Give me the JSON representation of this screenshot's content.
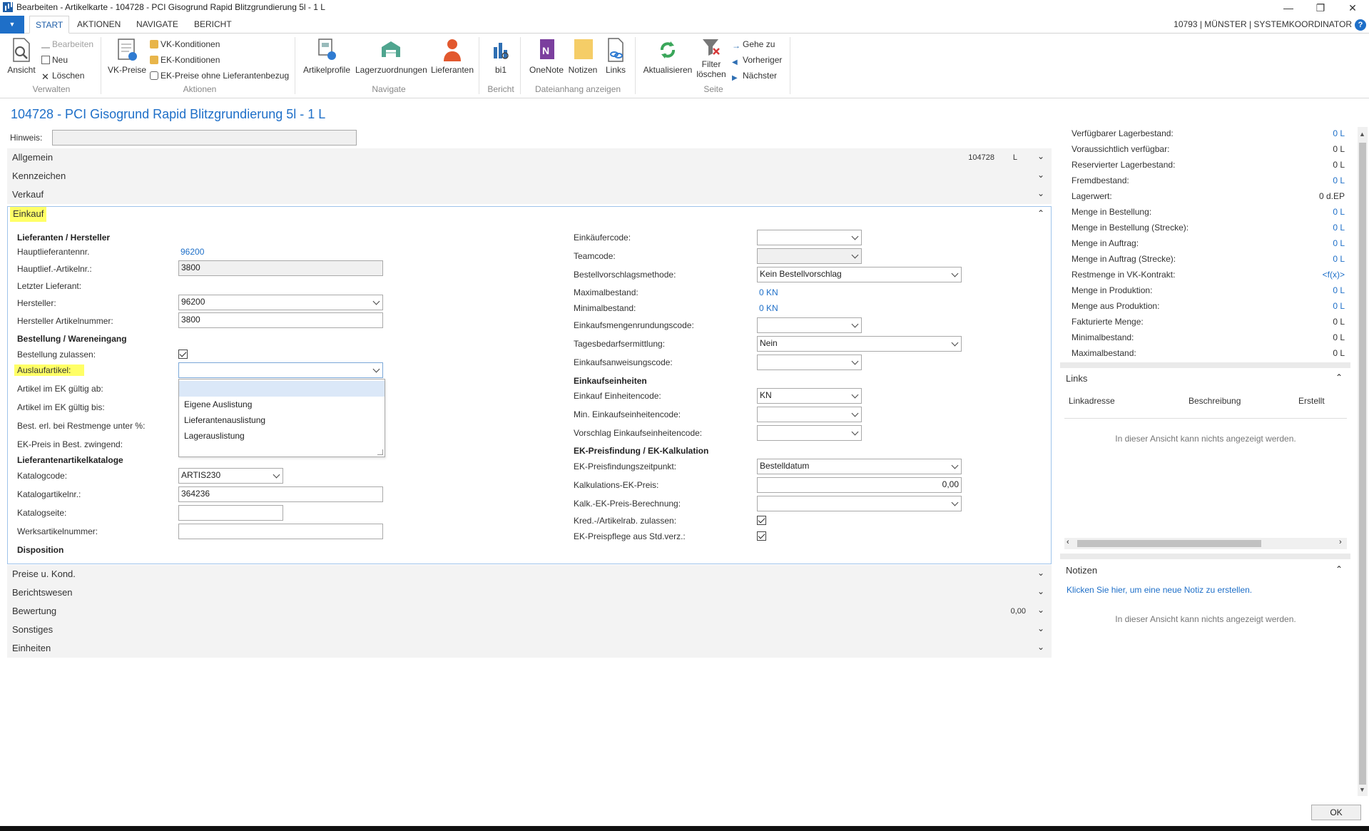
{
  "window": {
    "title": "Bearbeiten - Artikelkarte - 104728 - PCI Gisogrund Rapid Blitzgrundierung 5l - 1 L",
    "controls": {
      "minimize": "—",
      "restore": "❐",
      "close": "✕"
    }
  },
  "ribbon_tabs": {
    "start": "START",
    "aktionen": "AKTIONEN",
    "navigate": "NAVIGATE",
    "bericht": "BERICHT"
  },
  "user_info": "10793 | MÜNSTER | SYSTEMKOORDINATOR",
  "ribbon": {
    "verwalten": {
      "label": "Verwalten",
      "ansicht": "Ansicht",
      "bearbeiten": "Bearbeiten",
      "neu": "Neu",
      "loeschen": "Löschen"
    },
    "aktionen": {
      "label": "Aktionen",
      "vk_preise": "VK-Preise",
      "vk_konditionen": "VK-Konditionen",
      "ek_konditionen": "EK-Konditionen",
      "ek_preise_ohne": "EK-Preise ohne Lieferantenbezug"
    },
    "navigate": {
      "label": "Navigate",
      "artikelprofile": "Artikelprofile",
      "lagerzuordnungen": "Lagerzuordnungen",
      "lieferanten": "Lieferanten"
    },
    "bericht": {
      "label": "Bericht",
      "bi1": "bi1"
    },
    "dateianhang": {
      "label": "Dateianhang anzeigen",
      "onenote": "OneNote",
      "notizen": "Notizen",
      "links": "Links"
    },
    "seite": {
      "label": "Seite",
      "aktualisieren": "Aktualisieren",
      "filter_line1": "Filter",
      "filter_line2": "löschen",
      "gehe_zu": "Gehe zu",
      "vorheriger": "Vorheriger",
      "naechster": "Nächster"
    }
  },
  "page_title": "104728 - PCI Gisogrund Rapid Blitzgrundierung 5l - 1 L",
  "hinweis": {
    "label": "Hinweis:",
    "value": ""
  },
  "fasttabs": {
    "allgemein": {
      "label": "Allgemein",
      "summary1": "104728",
      "summary2": "L"
    },
    "kennzeichen": {
      "label": "Kennzeichen"
    },
    "verkauf": {
      "label": "Verkauf"
    },
    "einkauf": {
      "label": "Einkauf"
    },
    "preise": {
      "label": "Preise u. Kond."
    },
    "berichtswesen": {
      "label": "Berichtswesen"
    },
    "bewertung": {
      "label": "Bewertung",
      "summary1": "0,00"
    },
    "sonstiges": {
      "label": "Sonstiges"
    },
    "einheiten": {
      "label": "Einheiten"
    }
  },
  "einkauf_left": {
    "sec_lieferanten": "Lieferanten / Hersteller",
    "hauptlieferantennr": {
      "label": "Hauptlieferantennr.",
      "value": "96200"
    },
    "hauptlief_artikelnr": {
      "label": "Hauptlief.-Artikelnr.:",
      "value": "3800"
    },
    "letzter_lieferant": {
      "label": "Letzter Lieferant:"
    },
    "hersteller": {
      "label": "Hersteller:",
      "value": "96200"
    },
    "hersteller_artikelnummer": {
      "label": "Hersteller Artikelnummer:",
      "value": "3800"
    },
    "sec_bestellung": "Bestellung / Wareneingang",
    "bestellung_zulassen": {
      "label": "Bestellung zulassen:",
      "checked": true
    },
    "auslaufartikel": {
      "label": "Auslaufartikel:",
      "value": ""
    },
    "artikel_ek_ab": {
      "label": "Artikel im EK gültig ab:"
    },
    "artikel_ek_bis": {
      "label": "Artikel im EK gültig bis:"
    },
    "best_erl": {
      "label": "Best. erl. bei Restmenge unter %:"
    },
    "ek_preis_best": {
      "label": "EK-Preis in Best. zwingend:"
    },
    "sec_katalog": "Lieferantenartikelkataloge",
    "katalogcode": {
      "label": "Katalogcode:",
      "value": "ARTIS230"
    },
    "katalogartikelnr": {
      "label": "Katalogartikelnr.:",
      "value": "364236"
    },
    "katalogseite": {
      "label": "Katalogseite:",
      "value": ""
    },
    "werksartikelnummer": {
      "label": "Werksartikelnummer:",
      "value": ""
    },
    "sec_disposition": "Disposition"
  },
  "auslauf_dropdown": {
    "options": [
      "",
      "Eigene Auslistung",
      "Lieferantenauslistung",
      "Lagerauslistung"
    ]
  },
  "einkauf_right": {
    "einkaeufercode": {
      "label": "Einkäufercode:",
      "value": ""
    },
    "teamcode": {
      "label": "Teamcode:",
      "value": ""
    },
    "bestellvorschlagsmethode": {
      "label": "Bestellvorschlagsmethode:",
      "value": "Kein Bestellvorschlag"
    },
    "maximalbestand": {
      "label": "Maximalbestand:",
      "value": "0 KN"
    },
    "minimalbestand": {
      "label": "Minimalbestand:",
      "value": "0 KN"
    },
    "einkaufsmengenrundungscode": {
      "label": "Einkaufsmengenrundungscode:",
      "value": ""
    },
    "tagesbedarfsermittlung": {
      "label": "Tagesbedarfsermittlung:",
      "value": "Nein"
    },
    "einkaufsanweisungscode": {
      "label": "Einkaufsanweisungscode:",
      "value": ""
    },
    "sec_einheiten": "Einkaufseinheiten",
    "einkauf_einheitencode": {
      "label": "Einkauf Einheitencode:",
      "value": "KN"
    },
    "min_einkaufseinheitencode": {
      "label": "Min. Einkaufseinheitencode:",
      "value": ""
    },
    "vorschlag_einkaufseinheitencode": {
      "label": "Vorschlag Einkaufseinheitencode:",
      "value": ""
    },
    "sec_preisfindung": "EK-Preisfindung / EK-Kalkulation",
    "ek_preisfindungszeitpunkt": {
      "label": "EK-Preisfindungszeitpunkt:",
      "value": "Bestelldatum"
    },
    "kalkulations_ek_preis": {
      "label": "Kalkulations-EK-Preis:",
      "value": "0,00"
    },
    "kalk_ek_preis_berechnung": {
      "label": "Kalk.-EK-Preis-Berechnung:",
      "value": ""
    },
    "kred_artikelrab": {
      "label": "Kred.-/Artikelrab. zulassen:",
      "checked": true
    },
    "ek_preispflege": {
      "label": "EK-Preispflege aus Std.verz.:",
      "checked": true
    }
  },
  "factbox_stock": [
    {
      "label": "Verfügbarer Lagerbestand:",
      "value": "0 L",
      "link": true
    },
    {
      "label": "Voraussichtlich verfügbar:",
      "value": "0 L",
      "link": false
    },
    {
      "label": "Reservierter Lagerbestand:",
      "value": "0 L",
      "link": false
    },
    {
      "label": "Fremdbestand:",
      "value": "0 L",
      "link": true
    },
    {
      "label": "Lagerwert:",
      "value": "0 d.EP",
      "link": false
    },
    {
      "label": "Menge in Bestellung:",
      "value": "0 L",
      "link": true
    },
    {
      "label": "Menge in Bestellung (Strecke):",
      "value": "0 L",
      "link": true
    },
    {
      "label": "Menge in Auftrag:",
      "value": "0 L",
      "link": true
    },
    {
      "label": "Menge in Auftrag (Strecke):",
      "value": "0 L",
      "link": true
    },
    {
      "label": "Restmenge in VK-Kontrakt:",
      "value": "<f(x)>",
      "link": true
    },
    {
      "label": "Menge in Produktion:",
      "value": "0 L",
      "link": true
    },
    {
      "label": "Menge aus Produktion:",
      "value": "0 L",
      "link": true
    },
    {
      "label": "Fakturierte Menge:",
      "value": "0 L",
      "link": false
    },
    {
      "label": "Minimalbestand:",
      "value": "0 L",
      "link": false
    },
    {
      "label": "Maximalbestand:",
      "value": "0 L",
      "link": false
    }
  ],
  "links_part": {
    "title": "Links",
    "columns": [
      "Linkadresse",
      "Beschreibung",
      "Erstellt"
    ],
    "empty": "In dieser Ansicht kann nichts angezeigt werden."
  },
  "notizen_part": {
    "title": "Notizen",
    "new_link": "Klicken Sie hier, um eine neue Notiz zu erstellen.",
    "empty": "In dieser Ansicht kann nichts angezeigt werden."
  },
  "ok_label": "OK",
  "colors": {
    "accent": "#1e6fc8",
    "highlight": "#ffff66",
    "link": "#1e6fc8"
  }
}
